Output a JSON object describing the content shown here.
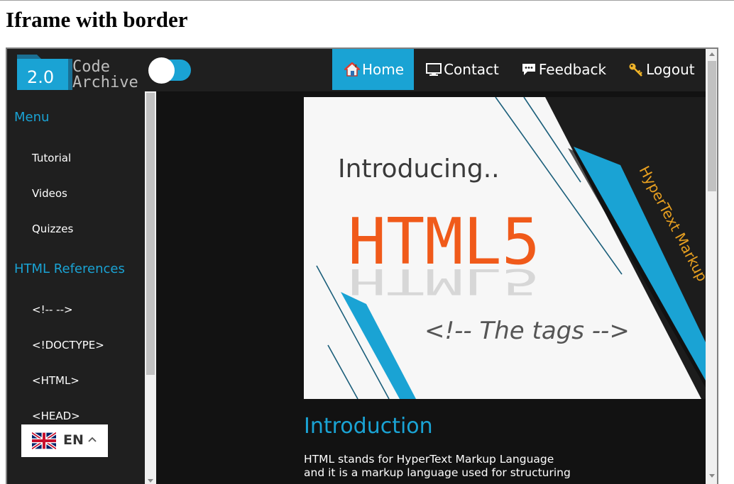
{
  "page": {
    "title": "Iframe with border"
  },
  "site": {
    "logo": {
      "version": "2.0",
      "line1": "Code",
      "line2": "Archive"
    },
    "nav": [
      {
        "label": "Home",
        "icon": "home-icon",
        "active": true
      },
      {
        "label": "Contact",
        "icon": "monitor-icon",
        "active": false
      },
      {
        "label": "Feedback",
        "icon": "speech-bubble-icon",
        "active": false
      },
      {
        "label": "Logout",
        "icon": "key-icon",
        "active": false
      }
    ],
    "theme_toggle": {
      "on": true
    },
    "sidebar": {
      "menu_heading": "Menu",
      "menu_items": [
        "Tutorial",
        "Videos",
        "Quizzes"
      ],
      "ref_heading": "HTML References",
      "ref_items": [
        "<!-- -->",
        "<!DOCTYPE>",
        "<HTML>",
        "<HEAD>"
      ]
    },
    "language": {
      "code": "EN",
      "flag": "uk-flag-icon"
    },
    "banner": {
      "intro_word": "Introducing..",
      "html5": "HTML5",
      "tags": "<!-- The tags -->",
      "side_text": "HyperText Markup"
    },
    "content": {
      "heading": "Introduction",
      "text": "HTML stands for HyperText Markup Language and it is a markup language used for structuring"
    },
    "colors": {
      "accent": "#1aa3d4",
      "nav_bg": "#1f1f1f",
      "content_bg": "#121212",
      "html5_orange": "#f05a1a",
      "side_text_gold": "#e8a020"
    }
  }
}
